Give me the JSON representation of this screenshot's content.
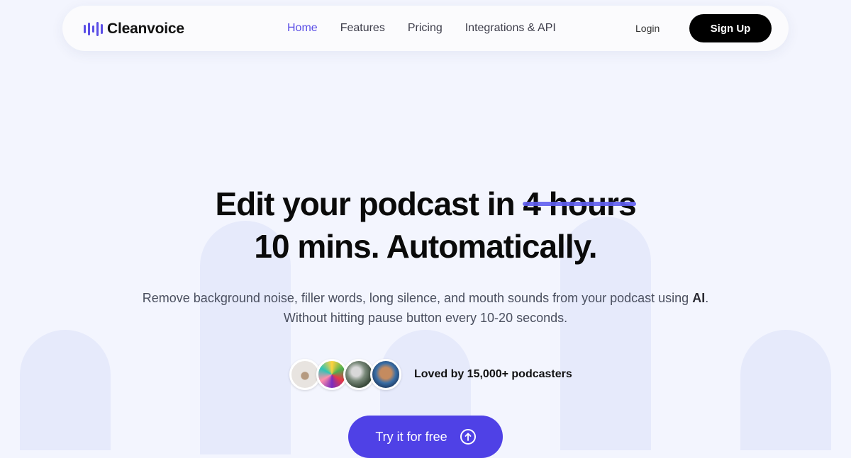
{
  "brand": {
    "name": "Cleanvoice",
    "accent": "#5a4ee6"
  },
  "nav": {
    "items": [
      {
        "label": "Home",
        "active": true
      },
      {
        "label": "Features",
        "active": false
      },
      {
        "label": "Pricing",
        "active": false
      },
      {
        "label": "Integrations & API",
        "active": false
      }
    ],
    "login": "Login",
    "signup": "Sign Up"
  },
  "hero": {
    "title_prefix": "Edit your podcast in",
    "title_struck": "4 hours",
    "title_line2": "10 mins. Automatically.",
    "subtitle_line1_pre": "Remove background noise, filler words, long silence, and mouth sounds from your podcast using",
    "subtitle_line1_bold": "AI",
    "subtitle_line1_post": ".",
    "subtitle_line2": "Without hitting pause button every 10-20 seconds."
  },
  "social_proof": {
    "text": "Loved by 15,000+ podcasters"
  },
  "cta": {
    "label": "Try it for free",
    "icon": "arrow-up-circle-icon",
    "color": "#4f41e6"
  }
}
